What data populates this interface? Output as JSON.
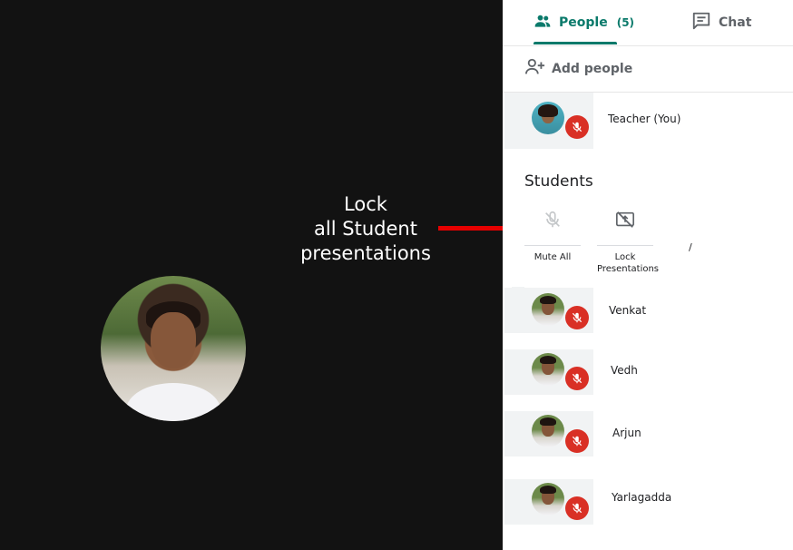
{
  "callout": {
    "text_lines": [
      "Lock",
      "all Student",
      "presentations"
    ],
    "line_color": "#e60000"
  },
  "tabs": {
    "people": {
      "label": "People",
      "count": "(5)",
      "icon": "people-icon"
    },
    "chat": {
      "label": "Chat",
      "icon": "chat-icon"
    }
  },
  "actions": {
    "add_people": "Add people"
  },
  "teacher": {
    "name": "Teacher (You)"
  },
  "students": {
    "title": "Students",
    "controls": {
      "mute_all": "Mute All",
      "lock_presentations": "Lock Presentations"
    },
    "stray_mark": "/",
    "list": [
      {
        "name": "Venkat"
      },
      {
        "name": "Vedh"
      },
      {
        "name": "Arjun"
      },
      {
        "name": "Yarlagadda"
      }
    ]
  },
  "colors": {
    "accent": "#0b7a6b",
    "muted_badge": "#d93025",
    "stage_bg": "#121212"
  }
}
